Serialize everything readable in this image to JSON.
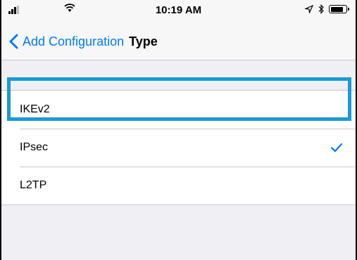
{
  "status_bar": {
    "time": "10:19 AM",
    "icons": [
      "signal-icon",
      "wifi-icon",
      "location-arrow-icon",
      "bluetooth-icon",
      "battery-icon"
    ]
  },
  "nav": {
    "back_label": "Add Configuration",
    "title": "Type"
  },
  "list": {
    "items": [
      {
        "label": "IKEv2",
        "selected": false
      },
      {
        "label": "IPsec",
        "selected": true
      },
      {
        "label": "L2TP",
        "selected": false
      }
    ]
  },
  "colors": {
    "accent": "#007aff",
    "highlight": "#1a9ad6",
    "background": "#efeff4"
  },
  "highlighted_item": "IKEv2"
}
